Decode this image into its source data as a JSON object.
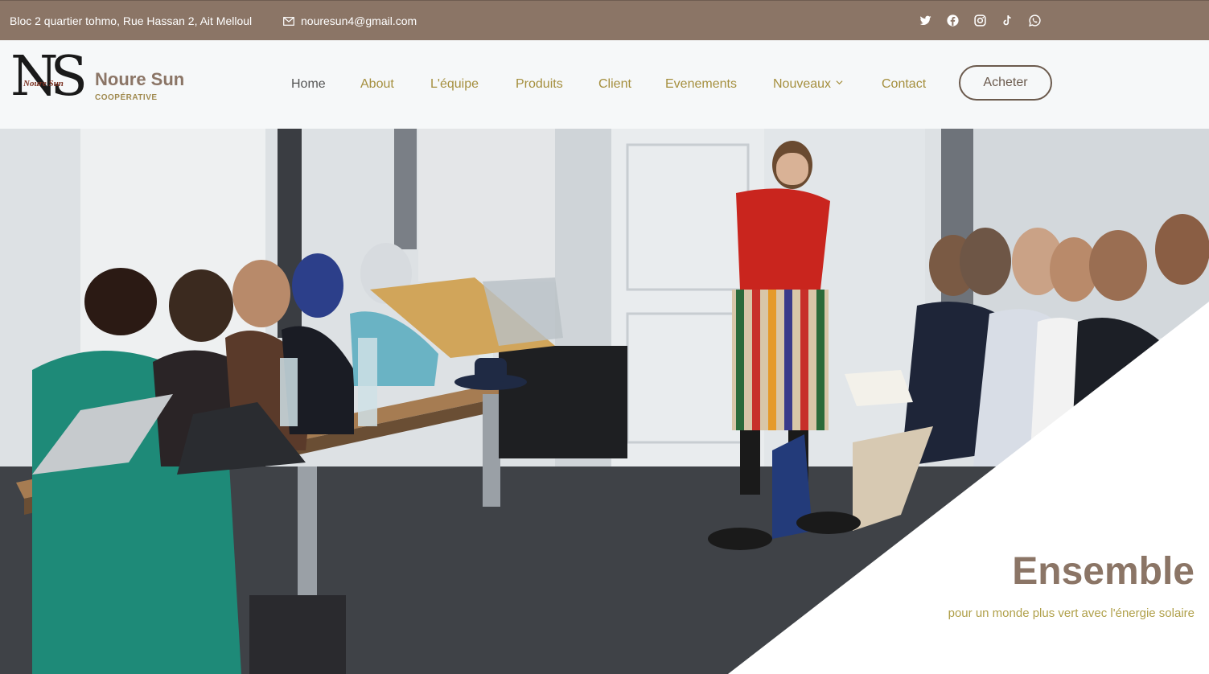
{
  "topbar": {
    "address": "Bloc 2 quartier tohmo, Rue Hassan 2, Ait Melloul",
    "email": "nouresun4@gmail.com",
    "social_icons": [
      "twitter-icon",
      "facebook-icon",
      "instagram-icon",
      "tiktok-icon",
      "whatsapp-icon"
    ]
  },
  "brand": {
    "monogram": "NS",
    "script": "Noure Sun",
    "name": "Noure Sun",
    "tagline": "COOPÉRATIVE"
  },
  "nav": {
    "items": [
      {
        "label": "Home"
      },
      {
        "label": "About"
      },
      {
        "label": "L'équipe"
      },
      {
        "label": "Produits"
      },
      {
        "label": "Client"
      },
      {
        "label": "Evenements"
      },
      {
        "label": "Nouveaux"
      },
      {
        "label": "Contact"
      }
    ],
    "cta": "Acheter"
  },
  "hero": {
    "title": "Ensemble",
    "subtitle": "pour un monde plus vert avec l'énergie solaire"
  },
  "colors": {
    "topbar": "#8b7566",
    "nav_text": "#a58f3e",
    "brand": "#8b7566",
    "accent_gold": "#b0a04a"
  }
}
